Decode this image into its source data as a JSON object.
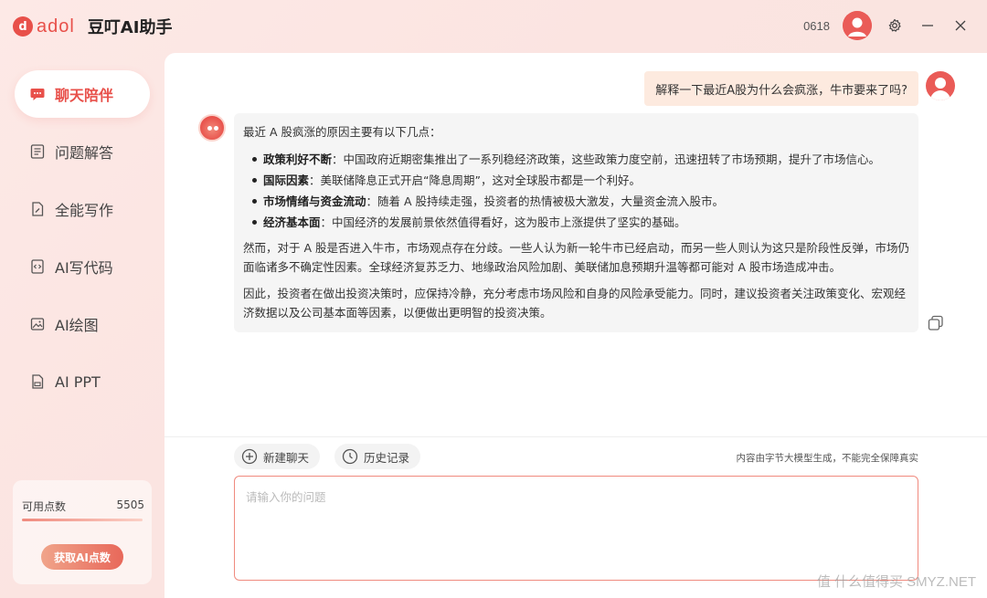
{
  "brand": {
    "logo_text": "adol",
    "app_title": "豆叮AI助手"
  },
  "titlebar": {
    "user_id": "0618"
  },
  "sidebar": {
    "items": [
      {
        "label": "聊天陪伴",
        "icon": "chat-bubble-icon",
        "active": true
      },
      {
        "label": "问题解答",
        "icon": "qa-list-icon",
        "active": false
      },
      {
        "label": "全能写作",
        "icon": "write-doc-icon",
        "active": false
      },
      {
        "label": "AI写代码",
        "icon": "code-doc-icon",
        "active": false
      },
      {
        "label": "AI绘图",
        "icon": "image-icon",
        "active": false
      },
      {
        "label": "AI PPT",
        "icon": "ppt-doc-icon",
        "active": false
      }
    ],
    "points": {
      "label": "可用点数",
      "value": "5505",
      "progress_percent": 100,
      "button_label": "获取AI点数"
    }
  },
  "chat": {
    "user_message": "解释一下最近A股为什么会疯涨，牛市要来了吗?",
    "bot_intro": "最近 A 股疯涨的原因主要有以下几点：",
    "bot_points": [
      {
        "title": "政策利好不断",
        "text": "：中国政府近期密集推出了一系列稳经济政策，这些政策力度空前，迅速扭转了市场预期，提升了市场信心。"
      },
      {
        "title": "国际因素",
        "text": "：美联储降息正式开启“降息周期”，这对全球股市都是一个利好。"
      },
      {
        "title": "市场情绪与资金流动",
        "text": "：随着 A 股持续走强，投资者的热情被极大激发，大量资金流入股市。"
      },
      {
        "title": "经济基本面",
        "text": "：中国经济的发展前景依然值得看好，这为股市上涨提供了坚实的基础。"
      }
    ],
    "bot_para2": "然而，对于 A 股是否进入牛市，市场观点存在分歧。一些人认为新一轮牛市已经启动，而另一些人则认为这只是阶段性反弹，市场仍面临诸多不确定性因素。全球经济复苏乏力、地缘政治风险加剧、美联储加息预期升温等都可能对 A 股市场造成冲击。",
    "bot_para3": "因此，投资者在做出投资决策时，应保持冷静，充分考虑市场风险和自身的风险承受能力。同时，建议投资者关注政策变化、宏观经济数据以及公司基本面等因素，以便做出更明智的投资决策。"
  },
  "toolbar": {
    "new_chat": "新建聊天",
    "history": "历史记录",
    "disclaimer": "内容由字节大模型生成，不能完全保障真实"
  },
  "input": {
    "placeholder": "请输入你的问题",
    "value": ""
  },
  "watermark": "值 什么值得买 SMYZ.NET",
  "colors": {
    "accent": "#e8504a",
    "user_bubble": "#fdeadf",
    "bot_bubble": "#f5f5f5"
  }
}
